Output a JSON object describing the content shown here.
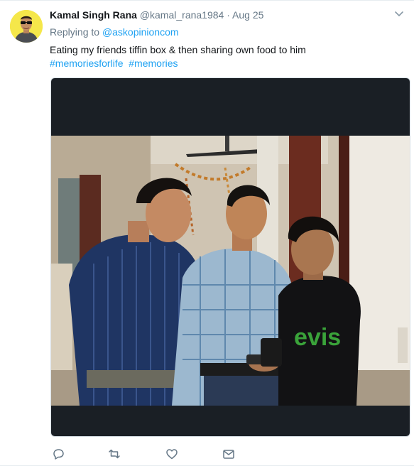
{
  "tweet": {
    "author_name": "Kamal Singh Rana",
    "handle": "@kamal_rana1984",
    "separator": "·",
    "date": "Aug 25",
    "replying_label": "Replying to",
    "replying_to": "@askopinioncom",
    "text": "Eating my friends tiffin box & then sharing own food to him",
    "hashtags": [
      "#memoriesforlife",
      "#memories"
    ]
  },
  "photo": {
    "shirt_text": "evis"
  },
  "actions": {
    "reply": "reply-icon",
    "retweet": "retweet-icon",
    "like": "heart-icon",
    "message": "envelope-icon"
  },
  "colors": {
    "link": "#1da1f2",
    "secondary_text": "#657786",
    "media_background": "#1a1f25",
    "avatar_background": "#f5e74a"
  }
}
